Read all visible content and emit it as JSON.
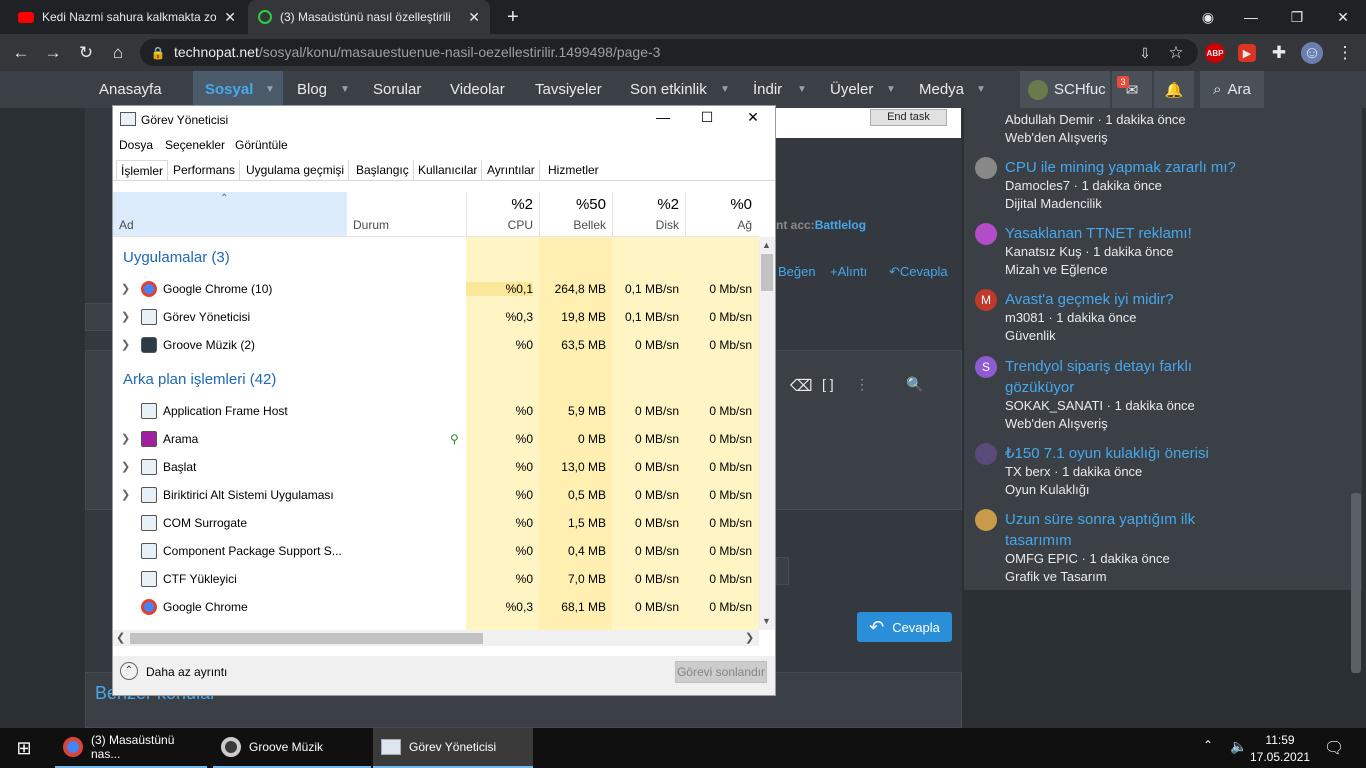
{
  "browser": {
    "tabs": [
      {
        "title": "Kedi Nazmi sahura kalkmakta zor",
        "icon": "youtube-icon"
      },
      {
        "title": "(3) Masaüstünü nasıl özelleştirilir",
        "icon": "technopat-icon"
      }
    ],
    "url_domain": "technopat.net",
    "url_path": "/sosyal/konu/masauestuenue-nasil-oezellestirilir.1499498/page-3",
    "abp": "ABP"
  },
  "site": {
    "nav": [
      "Anasayfa",
      "Sosyal",
      "Blog",
      "Sorular",
      "Videolar",
      "Tavsiyeler",
      "Son etkinlik",
      "İndir",
      "Üyeler",
      "Medya"
    ],
    "user": "SCHfuc",
    "badge": "3",
    "search": "Ara",
    "endtask": "End task",
    "battlelog_prefix": "nt acc:",
    "battlelog": "Battlelog",
    "begen": "Beğen",
    "alinti": "+Alıntı",
    "cevapla_link": "Cevapla",
    "cevapla_btn": "Cevapla",
    "benzer": "Benzer konular"
  },
  "sidebar": [
    {
      "title": "",
      "meta": "Abdullah Demir · 1 dakika önce",
      "cat": "Web'den Alışveriş",
      "avatar": "",
      "color": ""
    },
    {
      "title": "CPU ile mining yapmak zararlı mı?",
      "meta": "Damocles7 · 1 dakika önce",
      "cat": "Dijital Madencilik",
      "avatar": "",
      "color": "#888"
    },
    {
      "title": "Yasaklanan TTNET reklamı!",
      "meta": "Kanatsız Kuş · 1 dakika önce",
      "cat": "Mizah ve Eğlence",
      "avatar": "",
      "color": "#b24cc8"
    },
    {
      "title": "Avast'a geçmek iyi midir?",
      "meta": "m3081 · 1 dakika önce",
      "cat": "Güvenlik",
      "avatar": "M",
      "color": "#c0392b"
    },
    {
      "title": "Trendyol sipariş detayı farklı gözüküyor",
      "meta": "SOKAK_SANATI · 1 dakika önce",
      "cat": "Web'den Alışveriş",
      "avatar": "S",
      "color": "#8e5bd0"
    },
    {
      "title": "₺150 7.1 oyun kulaklığı önerisi",
      "meta": "TX berx · 1 dakika önce",
      "cat": "Oyun Kulaklığı",
      "avatar": "",
      "color": "#5a4a7a"
    },
    {
      "title": "Uzun süre sonra yaptığım ilk tasarımım",
      "meta": "OMFG EPIC · 1 dakika önce",
      "cat": "Grafik ve Tasarım",
      "avatar": "",
      "color": "#c89a4a"
    }
  ],
  "tm": {
    "title": "Görev Yöneticisi",
    "menus": [
      "Dosya",
      "Seçenekler",
      "Görüntüle"
    ],
    "tabs": [
      "İşlemler",
      "Performans",
      "Uygulama geçmişi",
      "Başlangıç",
      "Kullanıcılar",
      "Ayrıntılar",
      "Hizmetler"
    ],
    "col_name": "Ad",
    "col_status": "Durum",
    "cols": [
      {
        "pct": "%2",
        "label": "CPU"
      },
      {
        "pct": "%50",
        "label": "Bellek"
      },
      {
        "pct": "%2",
        "label": "Disk"
      },
      {
        "pct": "%0",
        "label": "Ağ"
      }
    ],
    "group_apps": "Uygulamalar (3)",
    "group_bg": "Arka plan işlemleri (42)",
    "apps": [
      {
        "name": "Google Chrome (10)",
        "cpu": "%0,1",
        "mem": "264,8 MB",
        "disk": "0,1 MB/sn",
        "net": "0 Mb/sn",
        "icon": "chrome-icon"
      },
      {
        "name": "Görev Yöneticisi",
        "cpu": "%0,3",
        "mem": "19,8 MB",
        "disk": "0,1 MB/sn",
        "net": "0 Mb/sn",
        "icon": "taskmgr-icon"
      },
      {
        "name": "Groove Müzik (2)",
        "cpu": "%0",
        "mem": "63,5 MB",
        "disk": "0 MB/sn",
        "net": "0 Mb/sn",
        "icon": "groove-icon"
      }
    ],
    "bg": [
      {
        "name": "Application Frame Host",
        "cpu": "%0",
        "mem": "5,9 MB",
        "disk": "0 MB/sn",
        "net": "0 Mb/sn",
        "exp": false
      },
      {
        "name": "Arama",
        "cpu": "%0",
        "mem": "0 MB",
        "disk": "0 MB/sn",
        "net": "0 Mb/sn",
        "exp": true
      },
      {
        "name": "Başlat",
        "cpu": "%0",
        "mem": "13,0 MB",
        "disk": "0 MB/sn",
        "net": "0 Mb/sn",
        "exp": true
      },
      {
        "name": "Biriktirici Alt Sistemi Uygulaması",
        "cpu": "%0",
        "mem": "0,5 MB",
        "disk": "0 MB/sn",
        "net": "0 Mb/sn",
        "exp": true
      },
      {
        "name": "COM Surrogate",
        "cpu": "%0",
        "mem": "1,5 MB",
        "disk": "0 MB/sn",
        "net": "0 Mb/sn",
        "exp": false
      },
      {
        "name": "Component Package Support S...",
        "cpu": "%0",
        "mem": "0,4 MB",
        "disk": "0 MB/sn",
        "net": "0 Mb/sn",
        "exp": false
      },
      {
        "name": "CTF Yükleyici",
        "cpu": "%0",
        "mem": "7,0 MB",
        "disk": "0 MB/sn",
        "net": "0 Mb/sn",
        "exp": false
      },
      {
        "name": "Google Chrome",
        "cpu": "%0,3",
        "mem": "68,1 MB",
        "disk": "0 MB/sn",
        "net": "0 Mb/sn",
        "exp": false
      }
    ],
    "less": "Daha az ayrıntı",
    "endtask": "Görevi sonlandır"
  },
  "taskbar": {
    "items": [
      "(3) Masaüstünü nas...",
      "Groove Müzik",
      "Görev Yöneticisi"
    ],
    "time": "11:59",
    "date": "17.05.2021"
  }
}
